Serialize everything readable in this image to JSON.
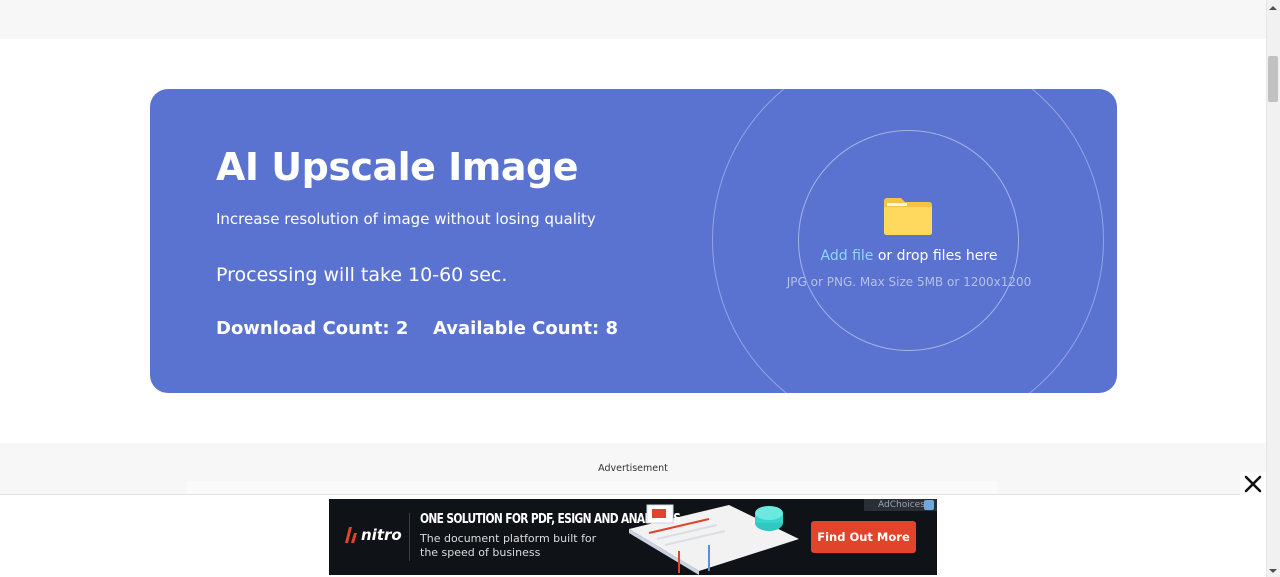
{
  "hero": {
    "title": "AI Upscale Image",
    "subtitle": "Increase resolution of image without losing quality",
    "processing": "Processing will take 10-60 sec.",
    "download_count": "Download Count: 2",
    "available_count": "Available Count: 8",
    "card_color": "#5a73d1"
  },
  "upload": {
    "add_file": "Add file",
    "drop_text": " or drop files here",
    "hint": "JPG or PNG. Max Size 5MB or 1200x1200",
    "link_color": "#8fd6ff",
    "icon": "folder-icon"
  },
  "ad": {
    "label": "Advertisement",
    "close_icon": "close-icon",
    "banner": {
      "logo": "nitro",
      "headline": "ONE SOLUTION FOR PDF, ESIGN AND ANALYTICS",
      "body": "The document platform built for the speed of business",
      "cta": "Find Out More",
      "adchoices": "AdChoices",
      "cta_color": "#e2432b"
    }
  }
}
